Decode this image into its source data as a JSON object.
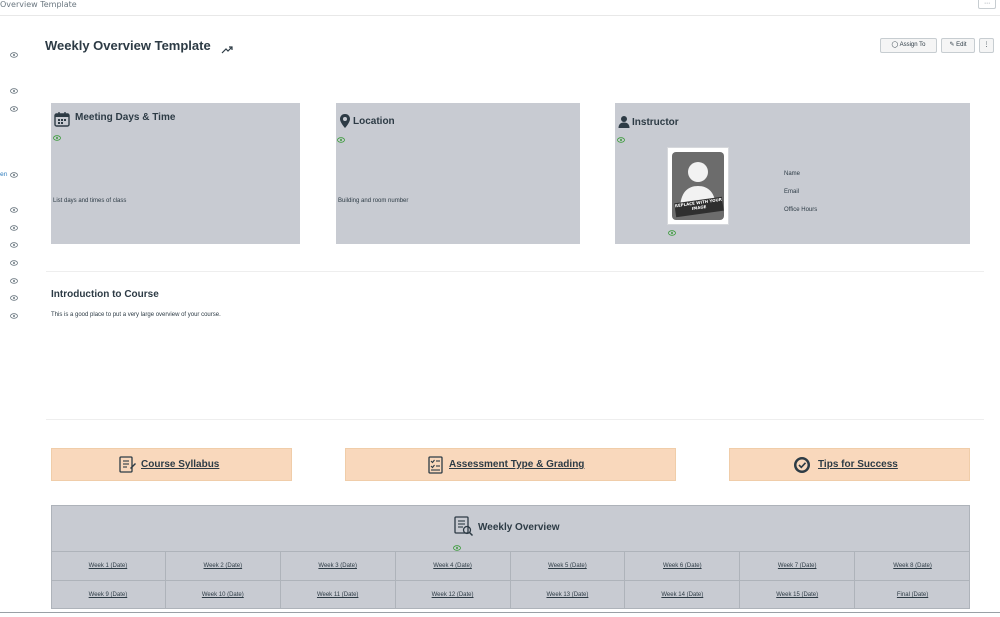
{
  "header": {
    "breadcrumb": "Overview Template",
    "menu_label": "⋯"
  },
  "page": {
    "title": "Weekly Overview Template",
    "assign_label": "Assign To",
    "edit_label": "Edit",
    "more_label": "⋮"
  },
  "sidebar": {
    "link_text": "en"
  },
  "cards": {
    "meeting": {
      "title": "Meeting Days & Time",
      "text": "List days and times of class"
    },
    "location": {
      "title": "Location",
      "text": "Building and room number"
    },
    "instructor": {
      "title": "Instructor",
      "photo_text": "REPLACE WITH YOUR IMAGE",
      "fields": [
        "Name",
        "Email",
        "Office Hours"
      ]
    }
  },
  "intro": {
    "title": "Introduction to Course",
    "text": "This is a good place to put a very large overview of your course."
  },
  "links": [
    {
      "label": "Course Syllabus"
    },
    {
      "label": "Assessment Type & Grading"
    },
    {
      "label": "Tips for Success"
    }
  ],
  "weekly": {
    "title": "Weekly Overview",
    "weeks": [
      "Week 1 (Date)",
      "Week 2 (Date)",
      "Week 3 (Date)",
      "Week 4 (Date)",
      "Week 5 (Date)",
      "Week 6 (Date)",
      "Week 7 (Date)",
      "Week 8 (Date)",
      "Week 9 (Date)",
      "Week 10 (Date)",
      "Week 11 (Date)",
      "Week 12 (Date)",
      "Week 13 (Date)",
      "Week 14 (Date)",
      "Week 15 (Date)",
      "Final (Date)"
    ]
  },
  "colors": {
    "card_bg": "#c8cbd2",
    "link_bg": "#f9d8bc",
    "text": "#2d3b45",
    "accent_link": "#2b7abc"
  },
  "icons": {
    "visibility": "eye-icon",
    "meeting": "calendar-icon",
    "location": "map-pin-icon",
    "instructor": "person-icon",
    "syllabus": "syllabus-icon",
    "assessment": "checklist-icon",
    "tips": "target-icon",
    "weekly": "list-icon"
  }
}
